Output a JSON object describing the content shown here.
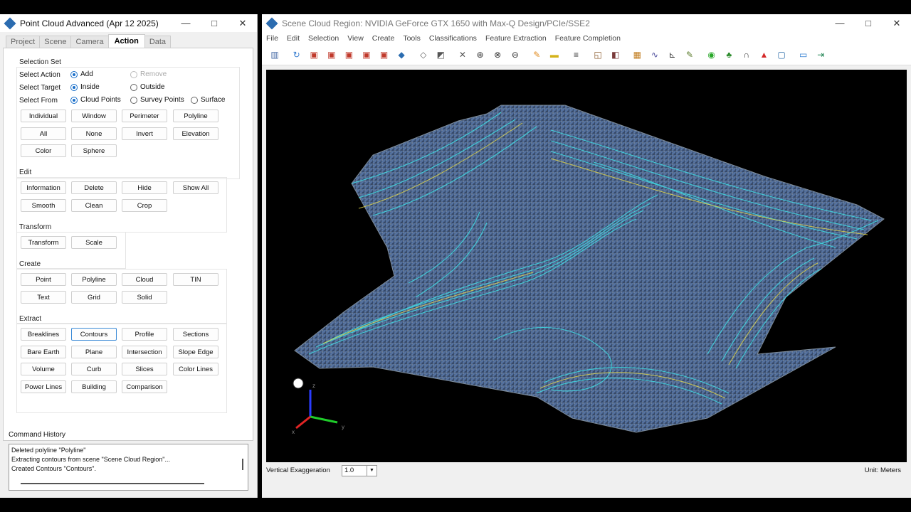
{
  "left_window": {
    "title": "Point Cloud Advanced (Apr 12 2025)",
    "tabs": [
      "Project",
      "Scene",
      "Camera",
      "Action",
      "Data"
    ],
    "active_tab": "Action",
    "selection_set": {
      "title": "Selection Set",
      "select_action_label": "Select Action",
      "select_target_label": "Select Target",
      "select_from_label": "Select From",
      "action_options": [
        "Add",
        "Remove"
      ],
      "target_options": [
        "Inside",
        "Outside"
      ],
      "from_options": [
        "Cloud Points",
        "Survey Points",
        "Surface"
      ],
      "buttons": [
        "Individual",
        "Window",
        "Perimeter",
        "Polyline",
        "All",
        "None",
        "Invert",
        "Elevation",
        "Color",
        "Sphere"
      ]
    },
    "edit": {
      "title": "Edit",
      "buttons": [
        "Information",
        "Delete",
        "Hide",
        "Show All",
        "Smooth",
        "Clean",
        "Crop"
      ]
    },
    "transform": {
      "title": "Transform",
      "buttons": [
        "Transform",
        "Scale"
      ]
    },
    "create": {
      "title": "Create",
      "buttons": [
        "Point",
        "Polyline",
        "Cloud",
        "TIN",
        "Text",
        "Grid",
        "Solid"
      ]
    },
    "extract": {
      "title": "Extract",
      "selected": "Contours",
      "buttons": [
        "Breaklines",
        "Contours",
        "Profile",
        "Sections",
        "Bare Earth",
        "Plane",
        "Intersection",
        "Slope Edge",
        "Volume",
        "Curb",
        "Slices",
        "Color Lines",
        "Power Lines",
        "Building",
        "Comparison"
      ]
    },
    "command_history": {
      "title": "Command History",
      "lines": [
        "Deleted polyline \"Polyline\"",
        "Extracting contours from scene \"Scene Cloud Region\"...",
        "Created Contours \"Contours\"."
      ]
    }
  },
  "right_window": {
    "title": "Scene Cloud Region: NVIDIA GeForce GTX 1650 with Max-Q Design/PCIe/SSE2",
    "menu": [
      "File",
      "Edit",
      "Selection",
      "View",
      "Create",
      "Tools",
      "Classifications",
      "Feature Extraction",
      "Feature Completion"
    ],
    "toolbar_icons": [
      "layout-icon",
      "rotate-icon",
      "view-front-icon",
      "view-top-icon",
      "view-right-icon",
      "view-back-icon",
      "view-left-icon",
      "view-iso-icon",
      "point-icon",
      "fit-plane-icon",
      "erase-icon",
      "zoom-window-icon",
      "zoom-extents-icon",
      "zoom-out-icon",
      "measure-icon",
      "ruler-icon",
      "layers-icon",
      "select-window-icon",
      "inspect-icon",
      "classify-icon",
      "contour-tool-icon",
      "profile-chart-icon",
      "edit-map-icon",
      "target-icon",
      "tree-icon",
      "curb-icon",
      "hydrant-icon",
      "frame-icon",
      "monitor-icon",
      "export-icon"
    ],
    "axis_labels": {
      "x": "x",
      "y": "y",
      "z": "z"
    },
    "vertical_exaggeration_label": "Vertical Exaggeration",
    "vertical_exaggeration_value": "1.0",
    "unit_label": "Unit:  Meters"
  }
}
